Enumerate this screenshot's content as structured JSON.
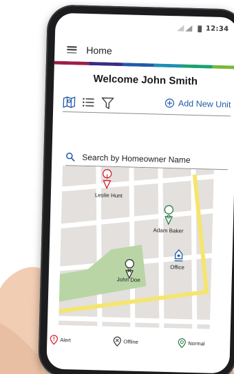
{
  "status_bar": {
    "time": "12:34"
  },
  "header": {
    "title": "Home",
    "menu_icon": "hamburger-menu-icon"
  },
  "brand_colors": [
    "#9c1f46",
    "#3c2b86",
    "#1f5aa8",
    "#1d8fb3",
    "#1aa071",
    "#79b83a"
  ],
  "welcome_text": "Welcome John Smith",
  "toolbar": {
    "views": [
      "map-view-icon",
      "list-view-icon",
      "filter-icon"
    ],
    "add_unit_label": "Add New Unit"
  },
  "search": {
    "placeholder": "Search by Homeowner Name"
  },
  "map": {
    "pins": [
      {
        "label": "Leslie Hunt",
        "status": "alert"
      },
      {
        "label": "Adam Baker",
        "status": "normal"
      },
      {
        "label": "Office",
        "status": "office"
      },
      {
        "label": "John Doe",
        "status": "offline"
      }
    ]
  },
  "legend": [
    {
      "label": "Alert",
      "color": "#d21e2b"
    },
    {
      "label": "Offline",
      "color": "#333333"
    },
    {
      "label": "Normal",
      "color": "#2c7a4b"
    }
  ]
}
